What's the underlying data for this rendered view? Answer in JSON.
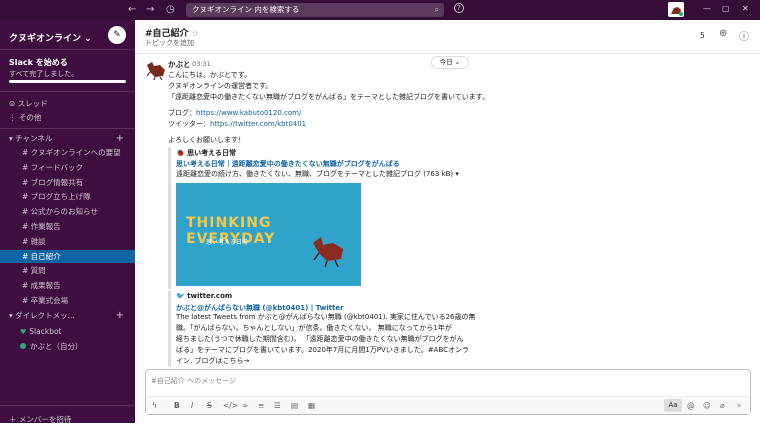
{
  "topbar": {
    "search_text": "クヌギオンライン 内を検索する",
    "help": "?",
    "back": "←",
    "forward": "→",
    "history": "◷",
    "min": "—",
    "max": "▢",
    "close": "✕"
  },
  "sidebar": {
    "workspace": "クヌギオンライン",
    "ws_chevron": "⌄",
    "getting_started_title": "Slack を始める",
    "getting_started_sub": "すべて完了しました。",
    "threads": "スレッド",
    "others": "その他",
    "channels_header": "チャンネル",
    "channels": [
      "# クヌギオンラインへの要望",
      "# フィードバック",
      "# ブログ情報共有",
      "# ブログ立ち上げ隊",
      "# 公式からのお知らせ",
      "# 作業報告",
      "# 雑談",
      "# 自己紹介",
      "# 質問",
      "# 成果報告",
      "# 卒業式会場"
    ],
    "dm_header": "ダイレクトメッ...",
    "dms": [
      "Slackbot",
      "かぶと（自分）"
    ],
    "add_members": "＋ メンバーを招待"
  },
  "header": {
    "channel": "#自己紹介",
    "star": "☆",
    "topic": "トピックを追加",
    "member_count": "5"
  },
  "message": {
    "author": "かぶと",
    "time": "03:31",
    "date_pill": "今日 ⌄",
    "lines": [
      "こんにちは。かぶとです。",
      "クヌギオンラインの運営者です。",
      "「遠距離恋愛中の働きたくない無職がブログをがんばる」をテーマとした雑記ブログを書いています。"
    ],
    "blog_label": "ブログ：",
    "blog_url": "https://www.kabuto0120.com/",
    "twitter_label": "ツイッター：",
    "twitter_url": "https://twitter.com/kbt0401",
    "closing": "よろしくお願いします！"
  },
  "attachment1": {
    "site": "思い考える日常",
    "link": "思い考える日常｜遠距離恋愛中の働きたくない無職がブログをがんばる",
    "desc": "遠距離恋愛の続け方、働きたくない、無職、ブログをテーマとした雑記ブログ (763 kB) ▾",
    "image_title": "THINKING EVERYDAY",
    "image_sub": "思い考える日常"
  },
  "attachment2": {
    "site": "twitter.com",
    "link": "かぶと@がんばらない無職 (@kbt0401) | Twitter",
    "desc": [
      "The latest Tweets from かぶと@がんばらない無職 (@kbt0401). 実家に住んでいる26歳の無",
      "職。「がんばらない。ちゃんとしない」が信条。働きたくない。 無職になってから1年が",
      "経ちました(うつで休職した期間含む)。 「遠距離恋愛中の働きたくない無職がブログをがん",
      "ばる」をテーマにブログを書いています。2020年7月に月間1万PVいきました。#ABCオンラ",
      "イン. ブログはこちら→"
    ]
  },
  "composer": {
    "placeholder": "#自己紹介 へのメッセージ",
    "aa": "Aa"
  },
  "colors": {
    "sidebar": "#3f0e40",
    "active": "#1164a3",
    "topbar": "#350d36"
  }
}
